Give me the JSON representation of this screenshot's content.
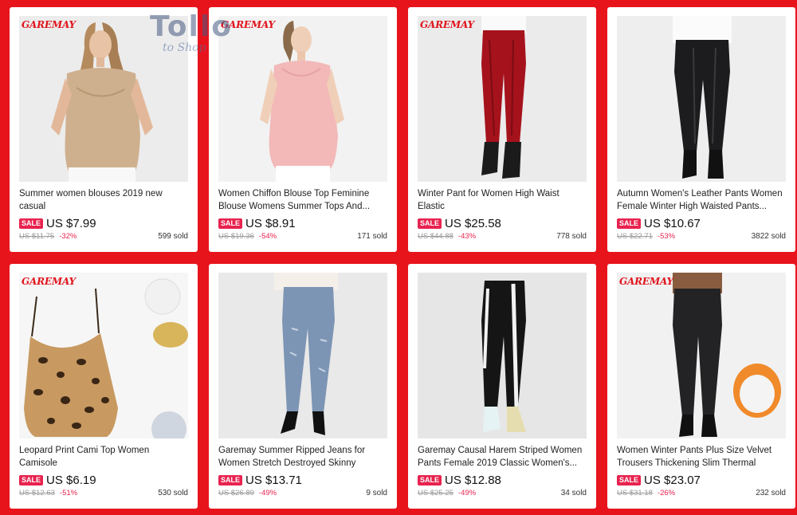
{
  "watermark": {
    "main": "Tollo",
    "sub": "to Shop"
  },
  "brand_logo": "GAREMAY",
  "colors": {
    "background": "#e8141c",
    "sale_badge": "#e8234f",
    "discount": "#e8234f"
  },
  "products": [
    {
      "title": "Summer women blouses 2019 new casual\nchiffon silk blouse slim sleeveless O-nec...",
      "badge": "SALE",
      "price": "US $7.99",
      "old_price": "US $11.75",
      "discount": "-32%",
      "sold": "599 sold",
      "show_brand": true,
      "image": "beige-silk-blouse"
    },
    {
      "title": "Women Chiffon Blouse Top Feminine\nBlouse Womens Summer Tops And...",
      "badge": "SALE",
      "price": "US $8.91",
      "old_price": "US $19.36",
      "discount": "-54%",
      "sold": "171 sold",
      "show_brand": true,
      "image": "pink-chiffon-blouse"
    },
    {
      "title": "Winter Pant for Women High Waist Elastic\nElegant Casual Down Pants Women's...",
      "badge": "SALE",
      "price": "US $25.58",
      "old_price": "US $44.88",
      "discount": "-43%",
      "sold": "778 sold",
      "show_brand": true,
      "image": "red-down-pants"
    },
    {
      "title": "Autumn Women's Leather Pants Women\nFemale Winter High Waisted Pants...",
      "badge": "SALE",
      "price": "US $10.67",
      "old_price": "US $22.71",
      "discount": "-53%",
      "sold": "3822 sold",
      "show_brand": false,
      "image": "black-leather-pants"
    },
    {
      "title": "Leopard Print Cami Top Women Camisole\nCasual Summer Streetwear Strap Silk...",
      "badge": "SALE",
      "price": "US $6.19",
      "old_price": "US $12.63",
      "discount": "-51%",
      "sold": "530 sold",
      "show_brand": true,
      "image": "leopard-cami-top"
    },
    {
      "title": "Garemay Summer Ripped Jeans for\nWomen Stretch Destroyed Skinny Jeans...",
      "badge": "SALE",
      "price": "US $13.71",
      "old_price": "US $26.89",
      "discount": "-49%",
      "sold": "9 sold",
      "show_brand": false,
      "image": "ripped-jeans"
    },
    {
      "title": "Garemay Causal Harem Striped Women\nPants Female 2019 Classic Women's...",
      "badge": "SALE",
      "price": "US $12.88",
      "old_price": "US $25.25",
      "discount": "-49%",
      "sold": "34 sold",
      "show_brand": false,
      "image": "striped-harem-pants"
    },
    {
      "title": "Women Winter Pants Plus Size Velvet\nTrousers Thickening Slim Thermal Femal...",
      "badge": "SALE",
      "price": "US $23.07",
      "old_price": "US $31.18",
      "discount": "-26%",
      "sold": "232 sold",
      "show_brand": true,
      "image": "velvet-thermal-pants"
    }
  ]
}
